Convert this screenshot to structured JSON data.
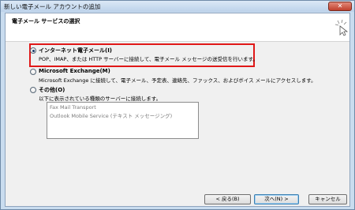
{
  "window": {
    "title": "新しい電子メール アカウントの追加",
    "close_label": "✕"
  },
  "header": {
    "title": "電子メール サービスの選択"
  },
  "options": [
    {
      "label": "インターネット電子メール(I)",
      "description": "POP、IMAP、または HTTP サーバーに接続して、電子メール メッセージの送受信を行います。",
      "checked": true
    },
    {
      "label": "Microsoft Exchange(M)",
      "description": "Microsoft Exchange に接続して、電子メール、予定表、連絡先、ファックス、およびボイス メールにアクセスします。",
      "checked": false
    },
    {
      "label": "その他(O)",
      "description": "以下に表示されている種類のサーバーに接続します。",
      "checked": false
    }
  ],
  "other_servers": [
    "Fax Mail Transport",
    "Outlook Mobile Service (テキスト メッセージング)"
  ],
  "buttons": {
    "back": "< 戻る(B)",
    "next": "次へ(N) >",
    "cancel": "キャンセル"
  }
}
